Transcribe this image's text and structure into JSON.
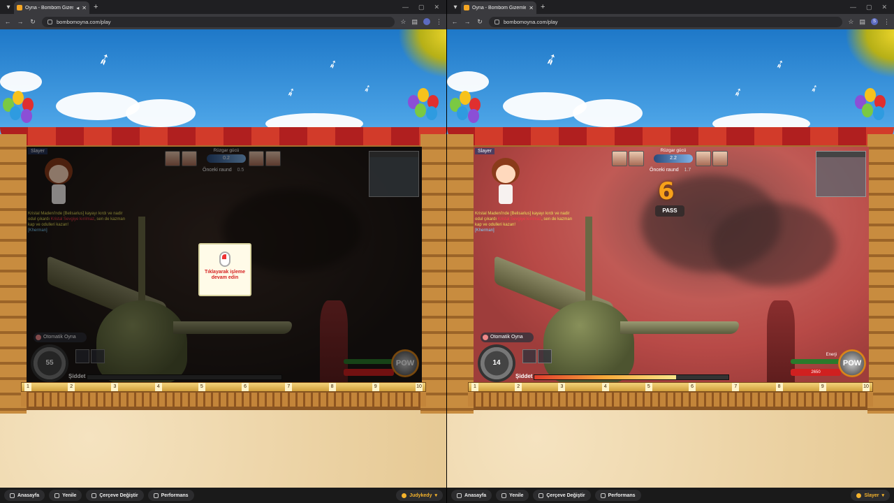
{
  "windows": [
    {
      "tab_title": "Oyna - Bombom Gizemler D",
      "url": "bombomoyna.com/play",
      "profile_initial": "",
      "player_name": "Slayer",
      "wind_label": "Rüzgar gücü",
      "wind_value": "0.2",
      "prev_round_label": "Önceki raund",
      "prev_round_value": "0.5",
      "chat": {
        "line1": "Kristal Madeni'nde [Belisarius] kayayı kırdı ve nadir",
        "line2_a": "odul çıkardı",
        "line2_hl": "Kristal Sevgiye kırılmaz",
        "line2_b": ", sen de kazman",
        "line3": "kap ve odulleri kazan!",
        "line4": "[Kherman]"
      },
      "auto_play": "Otomatik Oyna",
      "angle": "55",
      "power_label": "Şiddet",
      "power_level": 0,
      "hp_value": "",
      "pow_label": "POW",
      "resume_text": "Tıklayarak işleme devam edin",
      "bottom": {
        "home": "Anasayfa",
        "refresh": "Yenile",
        "frame": "Çerçeve Değiştir",
        "perf": "Performans",
        "user": "Judykedy"
      }
    },
    {
      "tab_title": "Oyna - Bombom Gizemler Diya",
      "url": "bombomoyna.com/play",
      "profile_initial": "S",
      "player_name": "Slayer",
      "wind_label": "Rüzgar gücü",
      "wind_value": "2.2",
      "prev_round_label": "Önceki raund",
      "prev_round_value": "1.7",
      "turn_timer": "6",
      "pass_label": "PASS",
      "chat": {
        "line1": "Kristal Madeni'nde [Belisarius] kayayı kırdı ve nadir",
        "line2_a": "odul çıkardı",
        "line2_hl": "Kristal Sevgiye kırılmaz",
        "line2_b": ", sen de kazman",
        "line3": "kap ve odulleri kazan!",
        "line4": "[Kherman]"
      },
      "auto_play": "Otomatik Oyna",
      "angle": "14",
      "power_label": "Şiddet",
      "power_level": 0.73,
      "hp_value": "2650",
      "energy_label": "Enerji",
      "pow_label": "POW",
      "bottom": {
        "home": "Anasayfa",
        "refresh": "Yenile",
        "frame": "Çerçeve Değiştir",
        "perf": "Performans",
        "user": "Slayer"
      }
    }
  ],
  "ruler_marks": [
    "1",
    "2",
    "3",
    "4",
    "5",
    "6",
    "7",
    "8",
    "9",
    "10"
  ],
  "colors": {
    "accent_user": "#f5b32c",
    "hp": "#d02020",
    "timer": "#f7a11a"
  }
}
